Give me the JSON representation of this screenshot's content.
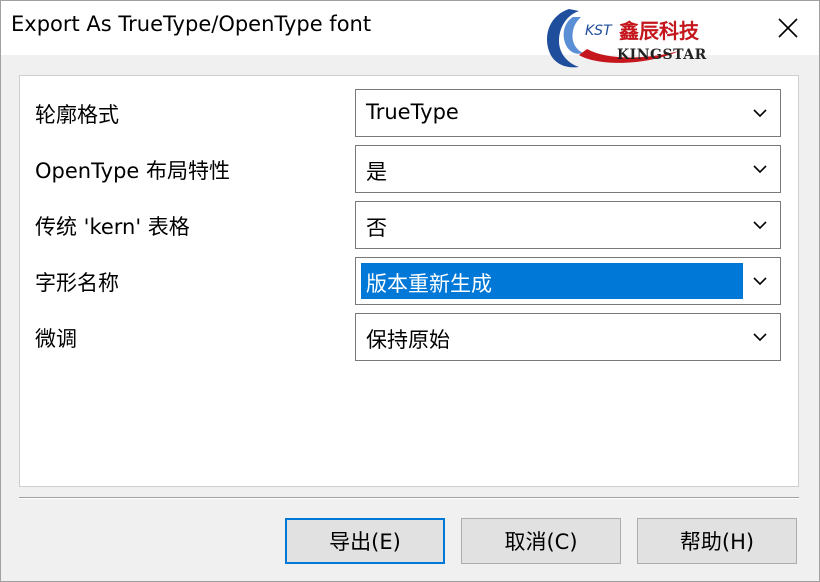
{
  "window": {
    "title": "Export As TrueType/OpenType font",
    "close_icon": "close-icon"
  },
  "logo": {
    "kst": "KST",
    "chinese": "鑫辰科技",
    "english": "KINGSTAR"
  },
  "fields": [
    {
      "label": "轮廓格式",
      "value": "TrueType"
    },
    {
      "label": "OpenType 布局特性",
      "value": "是"
    },
    {
      "label": "传统 'kern' 表格",
      "value": "否"
    },
    {
      "label": "字形名称",
      "value": "版本重新生成"
    },
    {
      "label": "微调",
      "value": "保持原始"
    }
  ],
  "buttons": {
    "export": "导出(E)",
    "cancel": "取消(C)",
    "help": "帮助(H)"
  },
  "colors": {
    "selection": "#0078d7",
    "logo_red": "#c4161c",
    "logo_blue": "#1f4e9c"
  }
}
